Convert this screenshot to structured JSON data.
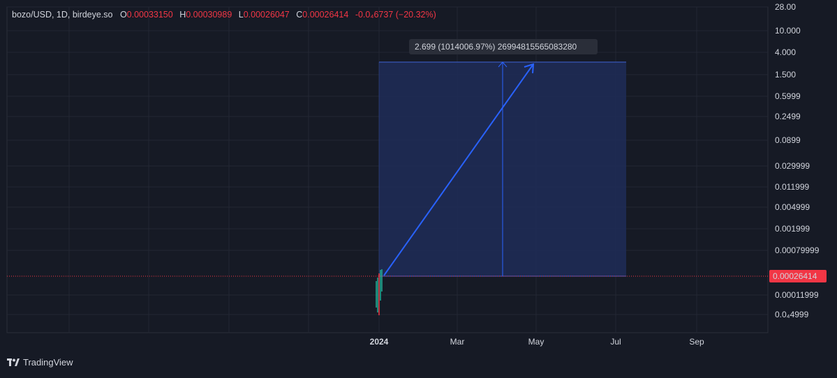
{
  "legend": {
    "symbol": "bozo/USD, 1D, birdeye.so",
    "o_label": "O",
    "o": "0.00033150",
    "h_label": "H",
    "h": "0.00030989",
    "l_label": "L",
    "l": "0.00026047",
    "c_label": "C",
    "c": "0.00026414",
    "change": "-0.0₄6737 (−20.32%)"
  },
  "brand": "TradingView",
  "colors": {
    "background": "#161a25",
    "grid": "#232733",
    "range_fill": "#1f2d58",
    "range_border": "#3f62d6",
    "arrow": "#2962ff",
    "price_tag": "#f23645",
    "up_candle": "#22ab94",
    "down_candle": "#f23645"
  },
  "chart_data": {
    "type": "candlestick",
    "symbol": "bozo/USD",
    "timeframe": "1D",
    "source": "birdeye.so",
    "y_scale": "log",
    "y_tick_labels": [
      "28.00",
      "10.000",
      "4.000",
      "1.500",
      "0.5999",
      "0.2499",
      "0.0899",
      "0.029999",
      "0.011999",
      "0.004999",
      "0.001999",
      "0.00079999",
      "0.00026414",
      "0.00011999",
      "0.0₄4999"
    ],
    "x_tick_labels": [
      "2024",
      "Mar",
      "May",
      "Jul",
      "Sep"
    ],
    "last_price": "0.00026414",
    "measure_tool": {
      "label": "2.699 (1014006.97%) 26994815565083280"
    }
  }
}
